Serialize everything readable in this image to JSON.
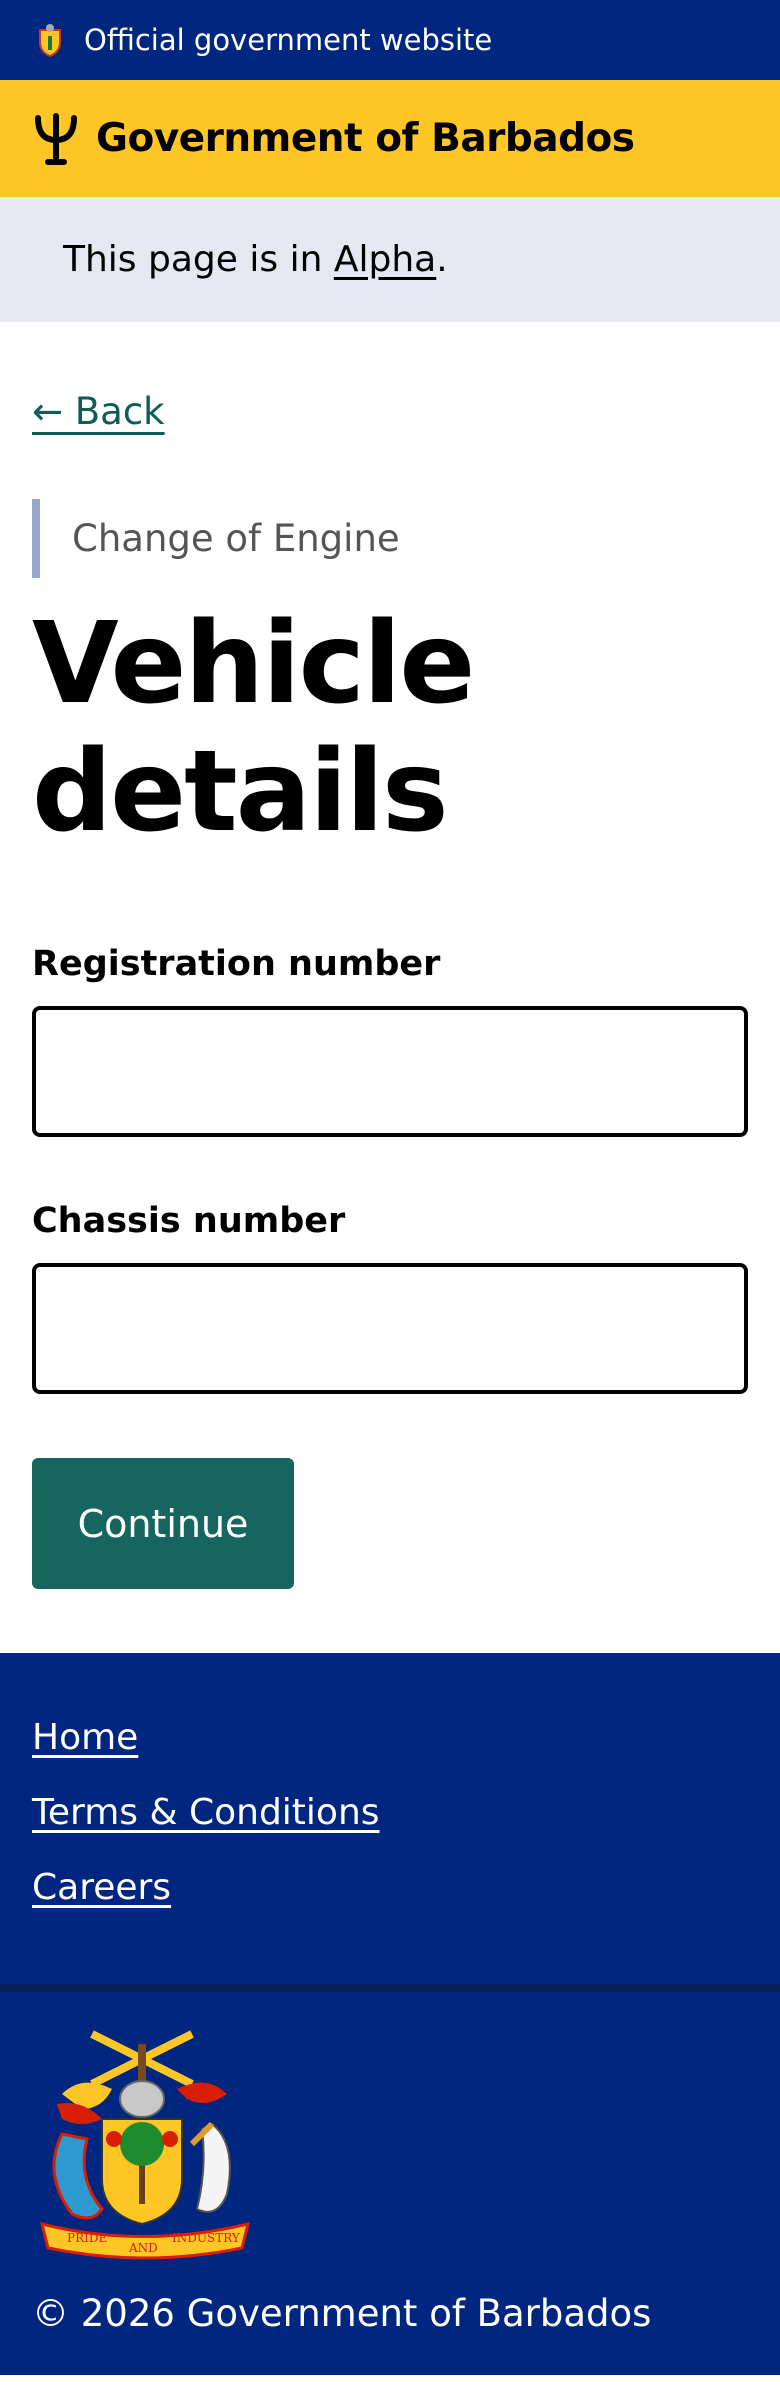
{
  "official_bar": {
    "text": "Official government website",
    "crest_icon": "barbados-crest-icon"
  },
  "header": {
    "title": "Government of Barbados",
    "logo_icon": "trident-icon"
  },
  "phase_banner": {
    "prefix": "This page is in ",
    "link": "Alpha",
    "suffix": "."
  },
  "back_link": "← Back",
  "caption": "Change of Engine",
  "page_title": "Vehicle details",
  "form": {
    "registration_label": "Registration number",
    "registration_value": "",
    "chassis_label": "Chassis number",
    "chassis_value": "",
    "continue_label": "Continue"
  },
  "footer": {
    "links": [
      "Home",
      "Terms & Conditions",
      "Careers"
    ],
    "motto_left": "PRIDE",
    "motto_mid": "AND",
    "motto_right": "INDUSTRY",
    "copyright": "© 2026 Government of Barbados"
  },
  "colors": {
    "navy": "#00267f",
    "gold": "#ffc726",
    "teal": "#16655f",
    "banner": "#e5e8f0"
  }
}
